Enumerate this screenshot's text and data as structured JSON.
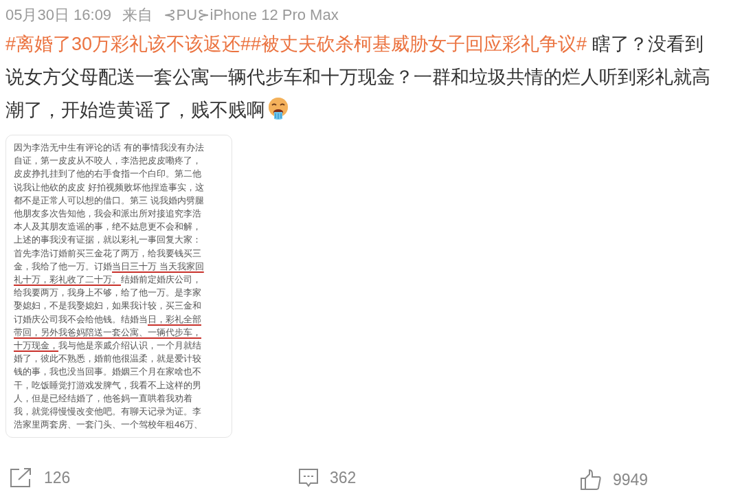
{
  "post_meta": {
    "date": "05月30日",
    "time": "16:09",
    "source_prefix": "来自",
    "source": "⊰PU⊱iPhone 12 Pro Max"
  },
  "post_text": [
    {
      "kind": "topic",
      "text": "#离婚了30万彩礼该不该返还#"
    },
    {
      "kind": "topic",
      "text": "#被丈夫砍杀柯基威胁女子回应彩礼争议#"
    },
    {
      "kind": "text",
      "text": " 瞎了？没看到说女方父母配送一套公寓一辆代步车和十万现金？一群和垃圾共情的烂人听到彩礼就高潮了，开始造黄谣了，贱不贱啊"
    },
    {
      "kind": "emoji"
    }
  ],
  "image_note": {
    "lines": [
      [
        {
          "text": "因为李浩无中生有评论的话 有的事情我没有办法",
          "underlined": false
        }
      ],
      [
        {
          "text": "自证，第一皮皮从不咬人，李浩把皮皮嘞疼了，",
          "underlined": false
        }
      ],
      [
        {
          "text": "皮皮挣扎挂到了他的右手食指一个白印。第二他",
          "underlined": false
        }
      ],
      [
        {
          "text": "说我让他砍的皮皮 好拍视频败坏他捏造事实，这",
          "underlined": false
        }
      ],
      [
        {
          "text": "都不是正常人可以想的借口。第三 说我婚内劈腿",
          "underlined": false
        }
      ],
      [
        {
          "text": "他朋友多次告知他，我会和派出所对接追究李浩",
          "underlined": false
        }
      ],
      [
        {
          "text": "本人及其朋友造谣的事，绝不姑息更不会和解，",
          "underlined": false
        }
      ],
      [
        {
          "text": "上述的事我没有证据，就以彩礼一事回复大家：",
          "underlined": false
        }
      ],
      [
        {
          "text": "首先李浩订婚前买三金花了两万，给我要钱买三",
          "underlined": false
        }
      ],
      [
        {
          "text": "金，我给了他一万。订婚",
          "underlined": false
        },
        {
          "text": "当日三十万 当天我家回",
          "underlined": true
        }
      ],
      [
        {
          "text": "礼十万，彩礼收了二十万。",
          "underlined": true
        },
        {
          "text": "结婚前定婚庆公司，",
          "underlined": false
        }
      ],
      [
        {
          "text": "给我要两万，我身上不够，给了他一万。是李家",
          "underlined": false
        }
      ],
      [
        {
          "text": "娶媳妇，不是我娶媳妇，如果我计较，买三金和",
          "underlined": false
        }
      ],
      [
        {
          "text": "订婚庆公司我不会给他钱。结婚当",
          "underlined": false
        },
        {
          "text": "日，彩礼全部",
          "underlined": true
        }
      ],
      [
        {
          "text": "带回，另外我爸妈陪送一套公寓、一辆代步车，",
          "underlined": true
        }
      ],
      [
        {
          "text": "十万现金，",
          "underlined": true
        },
        {
          "text": "我与他是亲戚介绍认识，一个月就结",
          "underlined": false
        }
      ],
      [
        {
          "text": "婚了，彼此不熟悉，婚前他很温柔，就是爱计较",
          "underlined": false
        }
      ],
      [
        {
          "text": "钱的事，我也没当回事。婚姻三个月在家啥也不",
          "underlined": false
        }
      ],
      [
        {
          "text": "干，吃饭睡觉打游戏发脾气，我看不上这样的男",
          "underlined": false
        }
      ],
      [
        {
          "text": "人，但是已经结婚了，他爸妈一直哄着我劝着",
          "underlined": false
        }
      ],
      [
        {
          "text": "我，就觉得慢慢改变他吧。有聊天记录为证。李",
          "underlined": false
        }
      ],
      [
        {
          "text": "浩家里两套房、一套门头、一个驾校年租46万、",
          "underlined": false
        }
      ]
    ]
  },
  "actions": [
    {
      "kind": "share",
      "count": "126"
    },
    {
      "kind": "comment",
      "count": "362"
    },
    {
      "kind": "like",
      "count": "9949"
    }
  ]
}
